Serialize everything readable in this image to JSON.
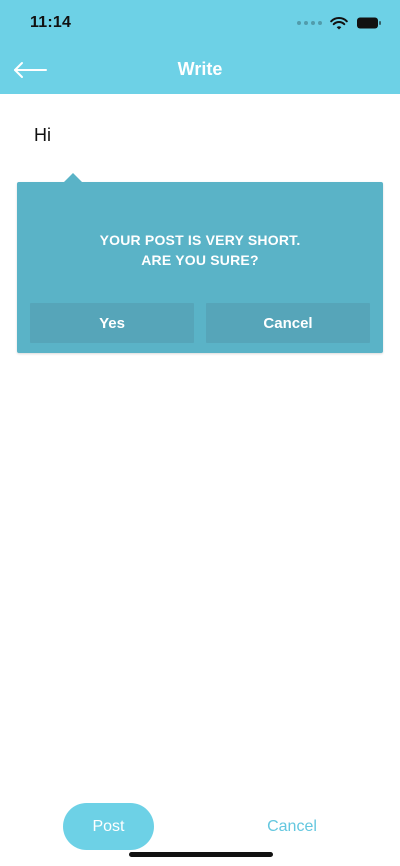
{
  "colors": {
    "header_bg": "#6DD1E6",
    "popover_bg": "#5AB3C7",
    "popover_button_bg": "#56A5B9",
    "post_button_bg": "#6DD1E6",
    "cancel_text": "#64C7DF",
    "status_text": "#111111"
  },
  "status_bar": {
    "time": "11:14",
    "icons": [
      "signal-dots-icon",
      "wifi-icon",
      "battery-icon"
    ]
  },
  "header": {
    "title": "Write",
    "back_icon": "back-arrow-icon"
  },
  "editor": {
    "text": "Hi"
  },
  "popover": {
    "message_line1": "YOUR POST IS VERY SHORT.",
    "message_line2": "ARE YOU SURE?",
    "yes_label": "Yes",
    "cancel_label": "Cancel"
  },
  "bottom": {
    "post_label": "Post",
    "cancel_label": "Cancel"
  }
}
